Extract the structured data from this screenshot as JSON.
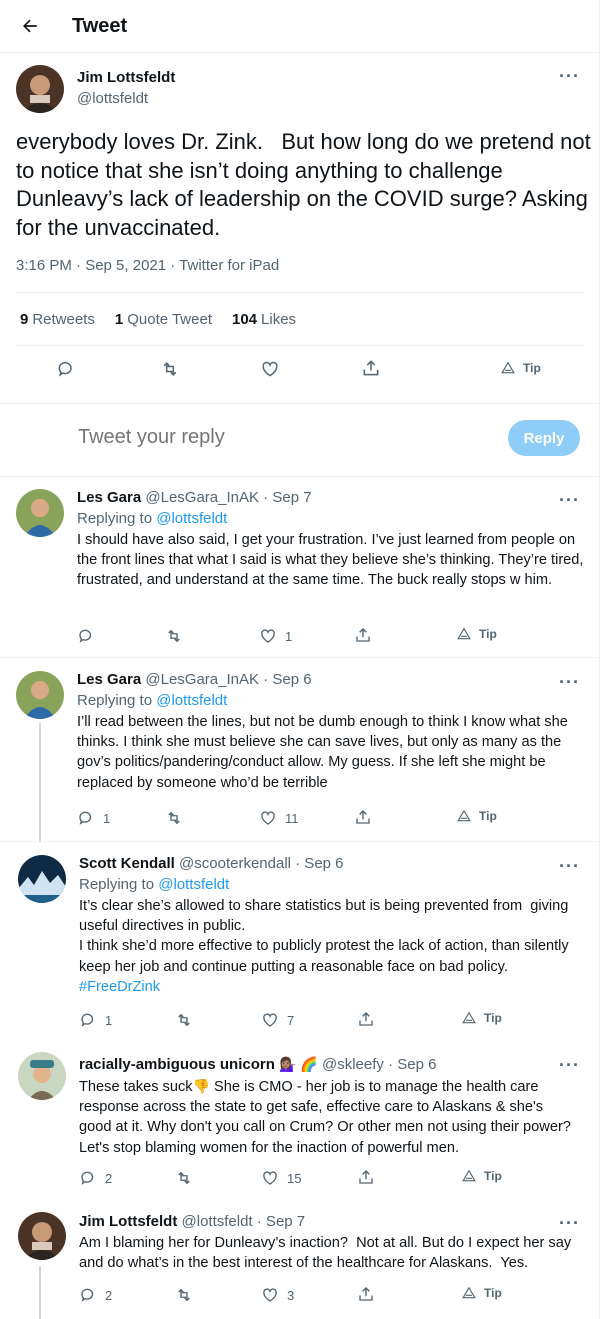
{
  "header": {
    "title": "Tweet"
  },
  "main_tweet": {
    "name": "Jim Lottsfeldt",
    "handle": "@lottsfeldt",
    "text": "everybody loves Dr. Zink.   But how long do we pretend not to notice that she isn’t doing anything to challenge Dunleavy’s lack of leadership on the COVID surge? Asking for the unvaccinated.",
    "meta": "3:16 PM · Sep 5, 2021 · Twitter for iPad",
    "retweets": "9",
    "retweets_label": "Retweets",
    "quotes": "1",
    "quotes_label": "Quote Tweet",
    "likes": "104",
    "likes_label": "Likes",
    "tip_label": "Tip"
  },
  "reply_box": {
    "placeholder": "Tweet your reply",
    "button": "Reply"
  },
  "replies": [
    {
      "name": "Les Gara",
      "sub": "@LesGara_InAK · Sep 7",
      "replying_prefix": "Replying to ",
      "replying_to": "@lottsfeldt",
      "text": "I should have also said, I get your frustration. I’ve just learned from people on the front lines that what I said is what they believe she’s thinking. They’re tired, frustrated, and understand at the same time. The buck really stops w him.",
      "replies": "",
      "likes": "1",
      "tip": "Tip"
    },
    {
      "name": "Les Gara",
      "sub": "@LesGara_InAK · Sep 6",
      "replying_prefix": "Replying to ",
      "replying_to": "@lottsfeldt",
      "text": "I’ll read between the lines, but not be dumb enough to think I know what she thinks. I think she must believe she can save lives, but only as many as the gov’s politics/pandering/conduct allow. My guess. If she left she might be replaced by someone who’d be terrible",
      "replies": "1",
      "likes": "11",
      "tip": "Tip"
    },
    {
      "name": "Scott Kendall",
      "sub": "@scooterkendall · Sep 6",
      "replying_prefix": "Replying to ",
      "replying_to": "@lottsfeldt",
      "text": "It’s clear she’s allowed to share statistics but is being prevented from  giving useful directives in public.\nI think she’d more effective to publicly protest the lack of action, than silently keep her job and continue putting a reasonable face on bad policy.",
      "hashtag": "#FreeDrZink",
      "replies": "1",
      "likes": "7",
      "tip": "Tip"
    },
    {
      "name": "racially-ambiguous unicorn",
      "name_emoji": "💁🏽‍♀️ 🌈",
      "sub": "@skleefy · Sep 6",
      "text_before": "These takes suck",
      "text_emoji": "👎",
      "text_after": " She is CMO - her job is to manage the health care response across the state to get safe, effective care to Alaskans & she's good at it. Why don't you call on Crum? Or other men not using their power? Let's stop blaming women for the inaction of powerful men.",
      "replies": "2",
      "likes": "15",
      "tip": "Tip"
    },
    {
      "name": "Jim Lottsfeldt",
      "sub": "@lottsfeldt · Sep 7",
      "text": "Am I blaming her for Dunleavy’s inaction?  Not at all. But do I expect her say and do what’s in the best interest of the healthcare for Alaskans.  Yes.",
      "replies": "2",
      "likes": "3",
      "tip": "Tip"
    }
  ],
  "colors": {
    "accent": "#1d9bf0",
    "muted": "#536471",
    "reply_button": "#8ecdf8",
    "divider": "#eff3f4"
  }
}
